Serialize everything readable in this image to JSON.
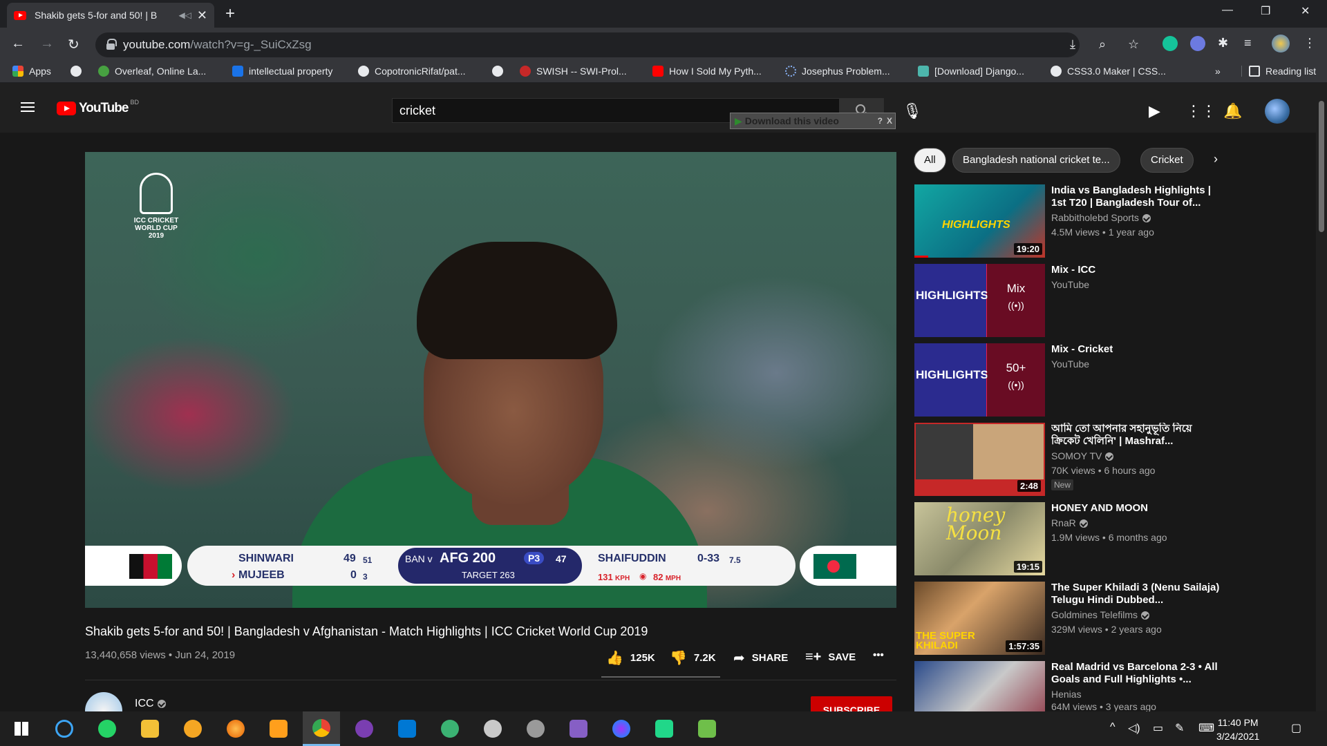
{
  "browser": {
    "tab_title": "Shakib gets 5-for and 50! | B",
    "url_host": "youtube.com",
    "url_path": "/watch?v=g-_SuiCxZsg",
    "bookmarks": [
      {
        "label": "Apps",
        "color": "#ea4335"
      },
      {
        "label": "",
        "color": "#e8eaed"
      },
      {
        "label": "Overleaf, Online La...",
        "color": "#47a141"
      },
      {
        "label": "intellectual property",
        "color": "#1a73e8"
      },
      {
        "label": "CopotronicRifat/pat...",
        "color": "#e8eaed"
      },
      {
        "label": "",
        "color": "#e8eaed"
      },
      {
        "label": "SWISH -- SWI-Prol...",
        "color": "#c62828"
      },
      {
        "label": "How I Sold My Pyth...",
        "color": "#ff0000"
      },
      {
        "label": "Josephus Problem...",
        "color": "#5f6368"
      },
      {
        "label": "[Download] Django...",
        "color": "#4db6ac"
      },
      {
        "label": "CSS3.0 Maker | CSS...",
        "color": "#e8eaed"
      }
    ],
    "more_bookmarks": "»",
    "reading_list": "Reading list"
  },
  "youtube": {
    "logo_text": "YouTube",
    "country_code": "BD",
    "search_value": "cricket",
    "download_banner": "Download this video",
    "download_banner_help": "?",
    "download_banner_close": "X"
  },
  "player": {
    "logo_lines": [
      "ICC CRICKET",
      "WORLD CUP",
      "2019"
    ],
    "scorebar": {
      "batsman1": "SHINWARI",
      "batsman1_runs": "49",
      "batsman1_balls": "51",
      "batsman2": "MUJEEB",
      "batsman2_runs": "0",
      "batsman2_balls": "3",
      "teams_prefix": "BAN v",
      "team_score": "AFG 200",
      "powerplay": "P3",
      "overs": "47",
      "target": "TARGET 263",
      "bowler": "SHAIFUDDIN",
      "bowler_figures": "0-33",
      "bowler_overs": "7.5",
      "speed_kph_value": "131",
      "speed_kph_unit": "KPH",
      "speed_mph_value": "82",
      "speed_mph_unit": "MPH"
    }
  },
  "video": {
    "title": "Shakib gets 5-for and 50! | Bangladesh v Afghanistan - Match Highlights | ICC Cricket World Cup 2019",
    "meta": "13,440,658 views • Jun 24, 2019",
    "likes": "125K",
    "dislikes": "7.2K",
    "share_label": "SHARE",
    "save_label": "SAVE",
    "more_label": "•••",
    "channel_name": "ICC",
    "subscribe_label": "SUBSCRIBE"
  },
  "chips": [
    "All",
    "Bangladesh national cricket te...",
    "Cricket"
  ],
  "recommendations": [
    {
      "title": "India vs Bangladesh Highlights | 1st T20 | Bangladesh Tour of...",
      "channel": "Rabbitholebd Sports",
      "verified": true,
      "meta": "4.5M views • 1 year ago",
      "duration": "19:20",
      "thumb_text": "HIGHLIGHTS"
    },
    {
      "title": "Mix - ICC",
      "channel": "YouTube",
      "verified": false,
      "meta": "",
      "duration": "",
      "thumb_text": "HIGHLIGHTS",
      "mix_label": "Mix",
      "mix_icon": "((•))"
    },
    {
      "title": "Mix - Cricket",
      "channel": "YouTube",
      "verified": false,
      "meta": "",
      "duration": "",
      "thumb_text": "HIGHLIGHTS",
      "mix_label": "50+",
      "mix_icon": "((•))"
    },
    {
      "title": "আমি তো আপনার সহানুভূতি নিয়ে ক্রিকেট খেলিনি' | Mashraf...",
      "channel": "SOMOY TV",
      "verified": true,
      "meta": "70K views • 6 hours ago",
      "duration": "2:48",
      "badge": "New"
    },
    {
      "title": "HONEY AND MOON",
      "channel": "RnaR",
      "verified": true,
      "meta": "1.9M views • 6 months ago",
      "duration": "19:15",
      "thumb_text": "honey Moon"
    },
    {
      "title": "The Super Khiladi 3 (Nenu Sailaja) Telugu Hindi Dubbed...",
      "channel": "Goldmines Telefilms",
      "verified": true,
      "meta": "329M views • 2 years ago",
      "duration": "1:57:35",
      "thumb_text": "THE SUPER KHILADI"
    },
    {
      "title": "Real Madrid vs Barcelona 2-3 • All Goals and Full Highlights •...",
      "channel": "Henias",
      "verified": false,
      "meta": "64M views • 3 years ago",
      "duration": ""
    }
  ],
  "taskbar": {
    "time": "11:40 PM",
    "date": "3/24/2021"
  }
}
